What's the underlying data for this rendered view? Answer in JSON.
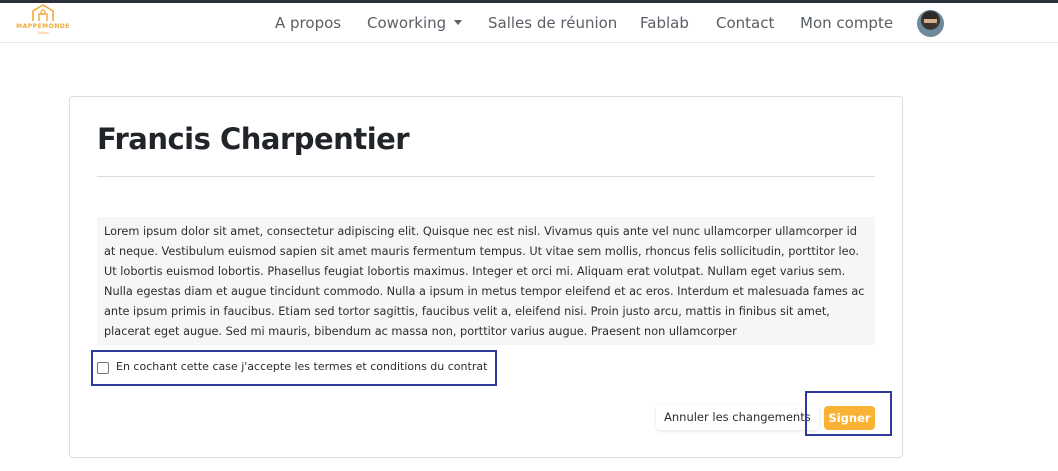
{
  "brand": {
    "name": "MAPPEMONDE",
    "subtitle": "Solbio",
    "accent_color": "#f2a93b"
  },
  "nav": {
    "items": [
      {
        "label": "A propos"
      },
      {
        "label": "Coworking",
        "has_dropdown": true
      },
      {
        "label": "Salles de réunion"
      },
      {
        "label": "Fablab"
      },
      {
        "label": "Contact"
      },
      {
        "label": "Mon compte"
      }
    ],
    "avatar_icon": "user-avatar"
  },
  "page": {
    "title": "Francis Charpentier",
    "terms_text": "Lorem ipsum dolor sit amet, consectetur adipiscing elit. Quisque nec est nisl. Vivamus quis ante vel nunc ullamcorper ullamcorper id at neque. Vestibulum euismod sapien sit amet mauris fermentum tempus. Ut vitae sem mollis, rhoncus felis sollicitudin, porttitor leo. Ut lobortis euismod lobortis. Phasellus feugiat lobortis maximus. Integer et orci mi. Aliquam erat volutpat. Nullam eget varius sem. Nulla egestas diam et augue tincidunt commodo. Nulla a ipsum in metus tempor eleifend et ac eros. Interdum et malesuada fames ac ante ipsum primis in faucibus. Etiam sed tortor sagittis, faucibus velit a, eleifend nisi. Proin justo arcu, mattis in finibus sit amet, placerat eget augue. Sed mi mauris, bibendum ac massa non, porttitor varius augue. Praesent non ullamcorper",
    "consent_label": "En cochant cette case j'accepte les termes et conditions du contrat",
    "consent_checked": false,
    "cancel_label": "Annuler les changements",
    "sign_label": "Signer",
    "sign_color": "#f9b233",
    "highlight_color": "#2e3a9c"
  }
}
